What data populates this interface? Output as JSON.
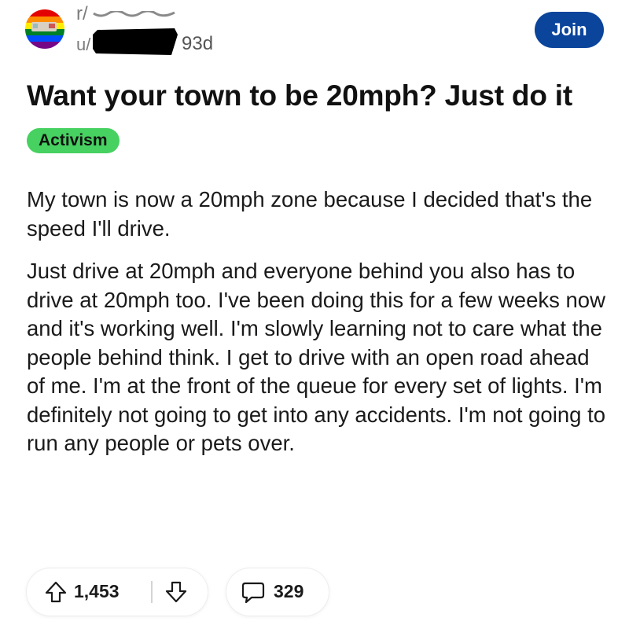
{
  "header": {
    "subreddit_prefix": "r/",
    "user_prefix": "u/",
    "age": "93d",
    "join_label": "Join"
  },
  "post": {
    "title": "Want your town to be 20mph? Just do it",
    "flair": "Activism",
    "paragraphs": [
      "My town is now a 20mph zone because I decided that's the speed I'll drive.",
      "Just drive at 20mph and everyone behind you also has to drive at 20mph too. I've been doing this for a few weeks now and it's working well. I'm slowly learning not to care what the people behind think. I get to drive with an open road ahead of me. I'm at the front of the queue for every set of lights. I'm definitely not going to get into any accidents. I'm not going to run any people or pets over."
    ]
  },
  "actions": {
    "score": "1,453",
    "comments": "329"
  },
  "icons": {
    "upvote": "arrow-up-icon",
    "downvote": "arrow-down-icon",
    "comment": "speech-bubble-icon"
  },
  "colors": {
    "join_button": "#0a449b",
    "flair_background": "#46d160",
    "redaction": "#000000"
  }
}
